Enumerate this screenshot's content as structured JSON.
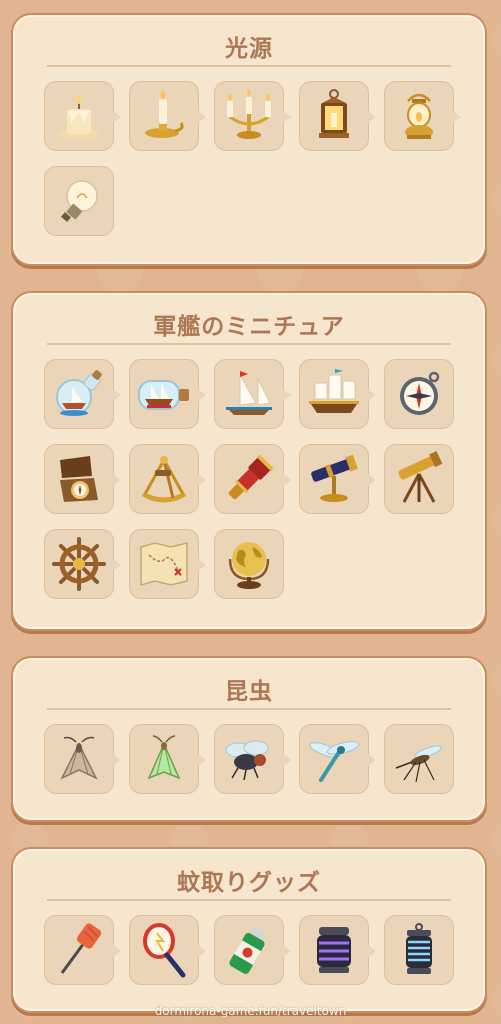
{
  "sections": [
    {
      "title": "光源",
      "items": [
        {
          "icon": "melted-candle-icon"
        },
        {
          "icon": "candlestick-icon"
        },
        {
          "icon": "candelabra-icon"
        },
        {
          "icon": "square-lantern-icon"
        },
        {
          "icon": "oil-lamp-icon"
        },
        {
          "icon": "light-bulb-icon"
        }
      ]
    },
    {
      "title": "軍艦のミニチュア",
      "items": [
        {
          "icon": "ship-in-round-bottle-icon"
        },
        {
          "icon": "ship-in-bottle-icon"
        },
        {
          "icon": "sailboat-icon"
        },
        {
          "icon": "galleon-ship-icon"
        },
        {
          "icon": "compass-icon"
        },
        {
          "icon": "open-compass-box-icon"
        },
        {
          "icon": "sextant-icon"
        },
        {
          "icon": "spyglass-icon"
        },
        {
          "icon": "telescope-on-stand-icon"
        },
        {
          "icon": "telescope-tripod-icon"
        },
        {
          "icon": "ship-wheel-icon"
        },
        {
          "icon": "treasure-map-icon"
        },
        {
          "icon": "globe-icon"
        }
      ]
    },
    {
      "title": "昆虫",
      "items": [
        {
          "icon": "moth-icon"
        },
        {
          "icon": "green-moth-icon"
        },
        {
          "icon": "fly-icon"
        },
        {
          "icon": "dragonfly-icon"
        },
        {
          "icon": "mosquito-icon"
        }
      ]
    },
    {
      "title": "蚊取りグッズ",
      "items": [
        {
          "icon": "fly-swatter-icon"
        },
        {
          "icon": "electric-swatter-icon"
        },
        {
          "icon": "bug-spray-icon"
        },
        {
          "icon": "purple-bug-zapper-icon"
        },
        {
          "icon": "blue-bug-zapper-icon"
        }
      ]
    }
  ],
  "watermark": "dormirona-game.fun/traveltown"
}
